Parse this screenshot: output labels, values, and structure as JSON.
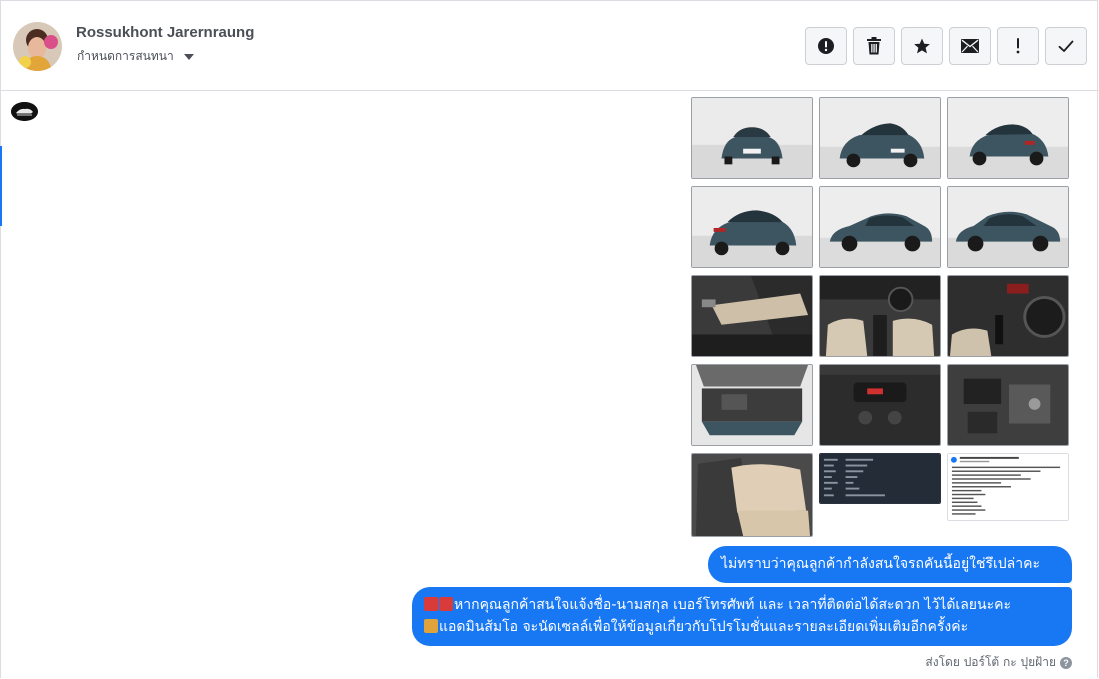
{
  "header": {
    "contact_name": "Rossukhont Jarernraung",
    "assign_label": "กำหนดการสนทนา",
    "actions": [
      {
        "name": "report-spam-button",
        "icon": "exclamation-circle-icon"
      },
      {
        "name": "delete-button",
        "icon": "trash-icon"
      },
      {
        "name": "star-button",
        "icon": "star-icon"
      },
      {
        "name": "mark-unread-button",
        "icon": "envelope-icon"
      },
      {
        "name": "follow-up-button",
        "icon": "exclamation-icon"
      },
      {
        "name": "mark-done-button",
        "icon": "check-icon"
      }
    ]
  },
  "attachments": {
    "images": [
      {
        "subject": "car-front-view"
      },
      {
        "subject": "car-front-angle-view"
      },
      {
        "subject": "car-rear-angle-view"
      },
      {
        "subject": "car-rear-angle-left-view"
      },
      {
        "subject": "car-side-right-view"
      },
      {
        "subject": "car-side-left-view"
      },
      {
        "subject": "car-door-interior"
      },
      {
        "subject": "car-dashboard-interior"
      },
      {
        "subject": "car-gear-shift-interior"
      },
      {
        "subject": "car-engine-bay"
      },
      {
        "subject": "car-center-console"
      },
      {
        "subject": "car-engine-detail"
      },
      {
        "subject": "car-rear-seats"
      },
      {
        "subject": "car-spec-screenshot"
      },
      {
        "subject": "facebook-post-screenshot"
      }
    ]
  },
  "messages": {
    "line1": "ไม่ทราบว่าคุณลูกค้ากำลังสนใจรถคันนี้อยู่ใช่รึเปล่าคะ",
    "line2a": "หากคุณลูกค้าสนใจแจ้งชื่อ-นามสกุล เบอร์โทรศัพท์ และ เวลาที่ติดต่อได้สะดวก ไว้ได้เลยนะคะ",
    "line2b": "แอดมินส้มโอ จะนัดเซลล์เพื่อให้ข้อมูลเกี่ยวกับโปรโมชั่นและรายละเอียดเพิ่มเติมอีกครั้งค่ะ"
  },
  "footer": {
    "sent_by": "ส่งโดย ปอร์โต้ กะ ปุยฝ้าย",
    "help_glyph": "?"
  },
  "colors": {
    "bubble": "#1877f2",
    "car_body": "#3d5560"
  }
}
